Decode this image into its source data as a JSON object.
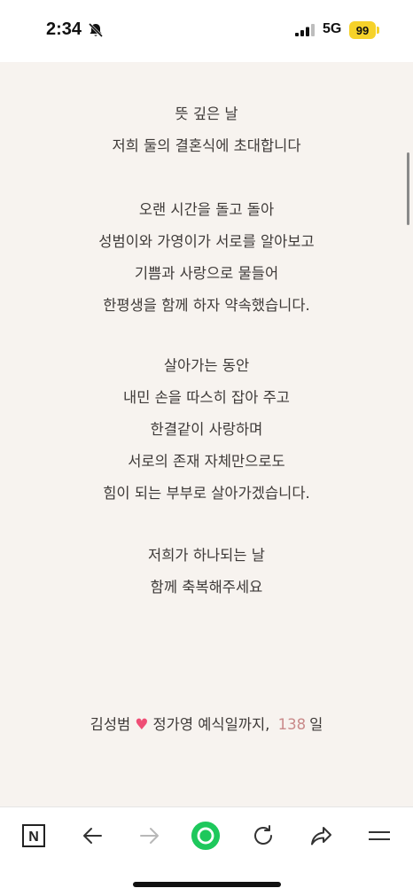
{
  "status_bar": {
    "time": "2:34",
    "network": "5G",
    "battery": "99"
  },
  "invitation": {
    "paragraphs": [
      [
        "뜻 깊은 날",
        "저희 둘의 결혼식에 초대합니다"
      ],
      [
        "오랜 시간을 돌고 돌아",
        "성범이와 가영이가 서로를 알아보고",
        "기쁨과 사랑으로 물들어",
        "한평생을 함께 하자 약속했습니다."
      ],
      [
        "살아가는 동안",
        "내민 손을 따스히 잡아 주고",
        "한결같이 사랑하며",
        "서로의 존재 자체만으로도",
        "힘이 되는 부부로 살아가겠습니다."
      ],
      [
        "저희가 하나되는 날",
        "함께 축복해주세요"
      ]
    ]
  },
  "dday": {
    "groom": "김성범",
    "bride_text": "정가영 예식일까지,",
    "days": "138",
    "unit": "일"
  },
  "colors": {
    "background": "#f7f3ef",
    "heart": "#ef4e75",
    "count": "#c98a8a",
    "accent_green": "#1ec85c",
    "battery": "#f6d22a"
  },
  "toolbar": {
    "buttons": [
      "naver-n-icon",
      "back-arrow-icon",
      "forward-arrow-icon",
      "green-dot-icon",
      "reload-icon",
      "share-icon",
      "menu-icon"
    ],
    "naver_label": "N"
  }
}
